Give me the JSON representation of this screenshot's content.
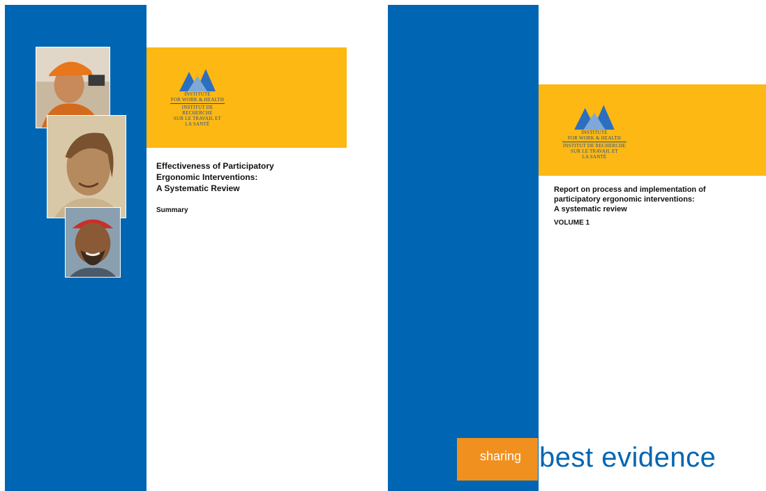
{
  "covers": {
    "left": {
      "logo_lines": [
        "INSTITUTE",
        "FOR WORK & HEALTH",
        "INSTITUT DE RECHERCHE",
        "SUR LE TRAVAIL ET",
        "LA SANTÉ"
      ],
      "title_lines": [
        "Effectiveness of Participatory",
        "Ergonomic Interventions:",
        "A Systematic Review"
      ],
      "subtitle": "Summary"
    },
    "right": {
      "logo_lines": [
        "INSTITUTE",
        "FOR WORK & HEALTH",
        "INSTITUT DE RECHERCHE",
        "SUR LE TRAVAIL ET",
        "LA SANTÉ"
      ],
      "title_lines": [
        "Report on process and implementation of",
        "participatory ergonomic interventions:",
        "A systematic review"
      ],
      "subtitle": "VOLUME 1",
      "tagline": {
        "word1": "sharing",
        "word2": "best evidence"
      }
    }
  },
  "colors": {
    "blue": "#0066b3",
    "gold": "#fdb813",
    "orange": "#f0901e",
    "logo": "#1d4f9a"
  },
  "icons": {
    "logo": "mountain-peaks-icon",
    "photos": [
      "worker-hardhat-photo",
      "woman-smiling-photo",
      "man-smiling-photo"
    ]
  }
}
